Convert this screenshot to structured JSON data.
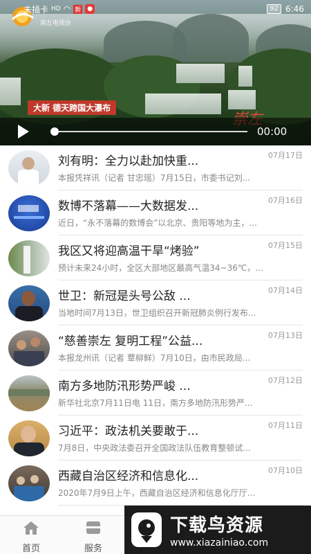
{
  "status": {
    "sim": "未插卡",
    "battery": "92",
    "time": "6:46",
    "station": "崇左电视台"
  },
  "video": {
    "caption": "大新 德天跨国大瀑布",
    "corner_text": "崇左",
    "time": "00:00",
    "progress": 0
  },
  "news": [
    {
      "title": "刘有明：全力以赴加快重...",
      "date": "07月17日",
      "summary": "本报凭祥讯（记者 甘忠瑶）7月15日，市委书记刘..."
    },
    {
      "title": "数博不落幕——大数据发...",
      "date": "07月16日",
      "summary": "近日，“永不落幕的数博会”以北京、贵阳等地为主，..."
    },
    {
      "title": "我区又将迎高温干旱“烤验”",
      "date": "07月15日",
      "summary": "预计未来24小时，全区大部地区最高气温34~36℃，..."
    },
    {
      "title": "世卫：新冠是头号公敌 ...",
      "date": "07月14日",
      "summary": "当地时间7月13日，世卫组织召开新冠肺炎例行发布..."
    },
    {
      "title": "“慈善崇左 复明工程”公益...",
      "date": "07月13日",
      "summary": "本报龙州讯（记者 覃柳鲜）7月10日，由市民政局..."
    },
    {
      "title": "南方多地防汛形势严峻 ...",
      "date": "07月12日",
      "summary": "新华社北京7月11日电 11日，南方多地防汛形势严..."
    },
    {
      "title": "习近平：政法机关要敢于...",
      "date": "07月11日",
      "summary": "7月8日，中央政法委召开全国政法队伍教育整顿试..."
    },
    {
      "title": "西藏自治区经济和信息化...",
      "date": "07月10日",
      "summary": "2020年7月9日上午，西藏自治区经济和信息化厅厅..."
    }
  ],
  "nav": [
    {
      "label": "首页"
    },
    {
      "label": "服务"
    }
  ],
  "watermark": {
    "title": "下载鸟资源",
    "url": "www.xiazainiao.com"
  }
}
